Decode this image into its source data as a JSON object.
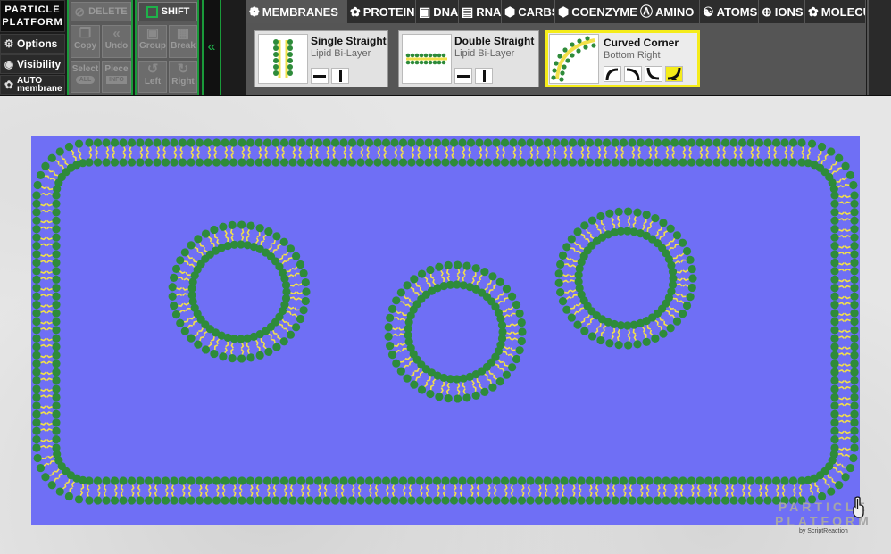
{
  "app": {
    "logo_line1": "PARTICLE",
    "logo_line2": "PLATFORM"
  },
  "left_menu": [
    {
      "label": "Options",
      "icon": "gear-icon"
    },
    {
      "label": "Visibility",
      "icon": "eye-icon"
    }
  ],
  "auto_membrane": {
    "line1": "AUTO",
    "line2": "membrane",
    "icon": "membrane-icon"
  },
  "edit_buttons": {
    "delete": "DELETE",
    "copy": "Copy",
    "undo": "Undo",
    "select": "Select",
    "select_badge": "ALL",
    "piece": "Piece",
    "piece_badge": "INFO"
  },
  "arrange_buttons": {
    "shift": "SHIFT",
    "group": "Group",
    "break": "Break",
    "left": "Left",
    "right": "Right"
  },
  "tabs": [
    {
      "label": "MEMBRANES",
      "icon": "membrane-icon",
      "active": true
    },
    {
      "label": "PROTEINS",
      "icon": "protein-icon",
      "active": false
    },
    {
      "label": "DNA",
      "icon": "dna-icon",
      "active": false
    },
    {
      "label": "RNA",
      "icon": "rna-icon",
      "active": false
    },
    {
      "label": "CARBS",
      "icon": "carbs-icon",
      "active": false
    },
    {
      "label": "COENZYMES",
      "icon": "coenzyme-icon",
      "active": false
    },
    {
      "label": "AMINO",
      "icon": "amino-icon",
      "active": false
    },
    {
      "label": "ATOMS",
      "icon": "atom-icon",
      "active": false
    },
    {
      "label": "IONS",
      "icon": "ion-icon",
      "active": false
    },
    {
      "label": "MOLECULES",
      "icon": "molecule-icon",
      "active": false
    }
  ],
  "pieces": [
    {
      "title": "Single Straight",
      "subtitle": "Lipid Bi-Layer",
      "selected": false
    },
    {
      "title": "Double Straight",
      "subtitle": "Lipid Bi-Layer",
      "selected": false
    },
    {
      "title": "Curved Corner",
      "subtitle": "Bottom Right",
      "selected": true
    }
  ],
  "colors": {
    "canvas_bg": "#6f6ff5",
    "lipid_head": "#2e8b3a",
    "lipid_tail": "#f2e04a",
    "accent_green": "#1fb14a",
    "selection_yellow": "#f5ec1a"
  },
  "watermark": {
    "line1": "PARTICLE",
    "line2": "PLATFORM",
    "byline": "by ScriptReaction"
  }
}
